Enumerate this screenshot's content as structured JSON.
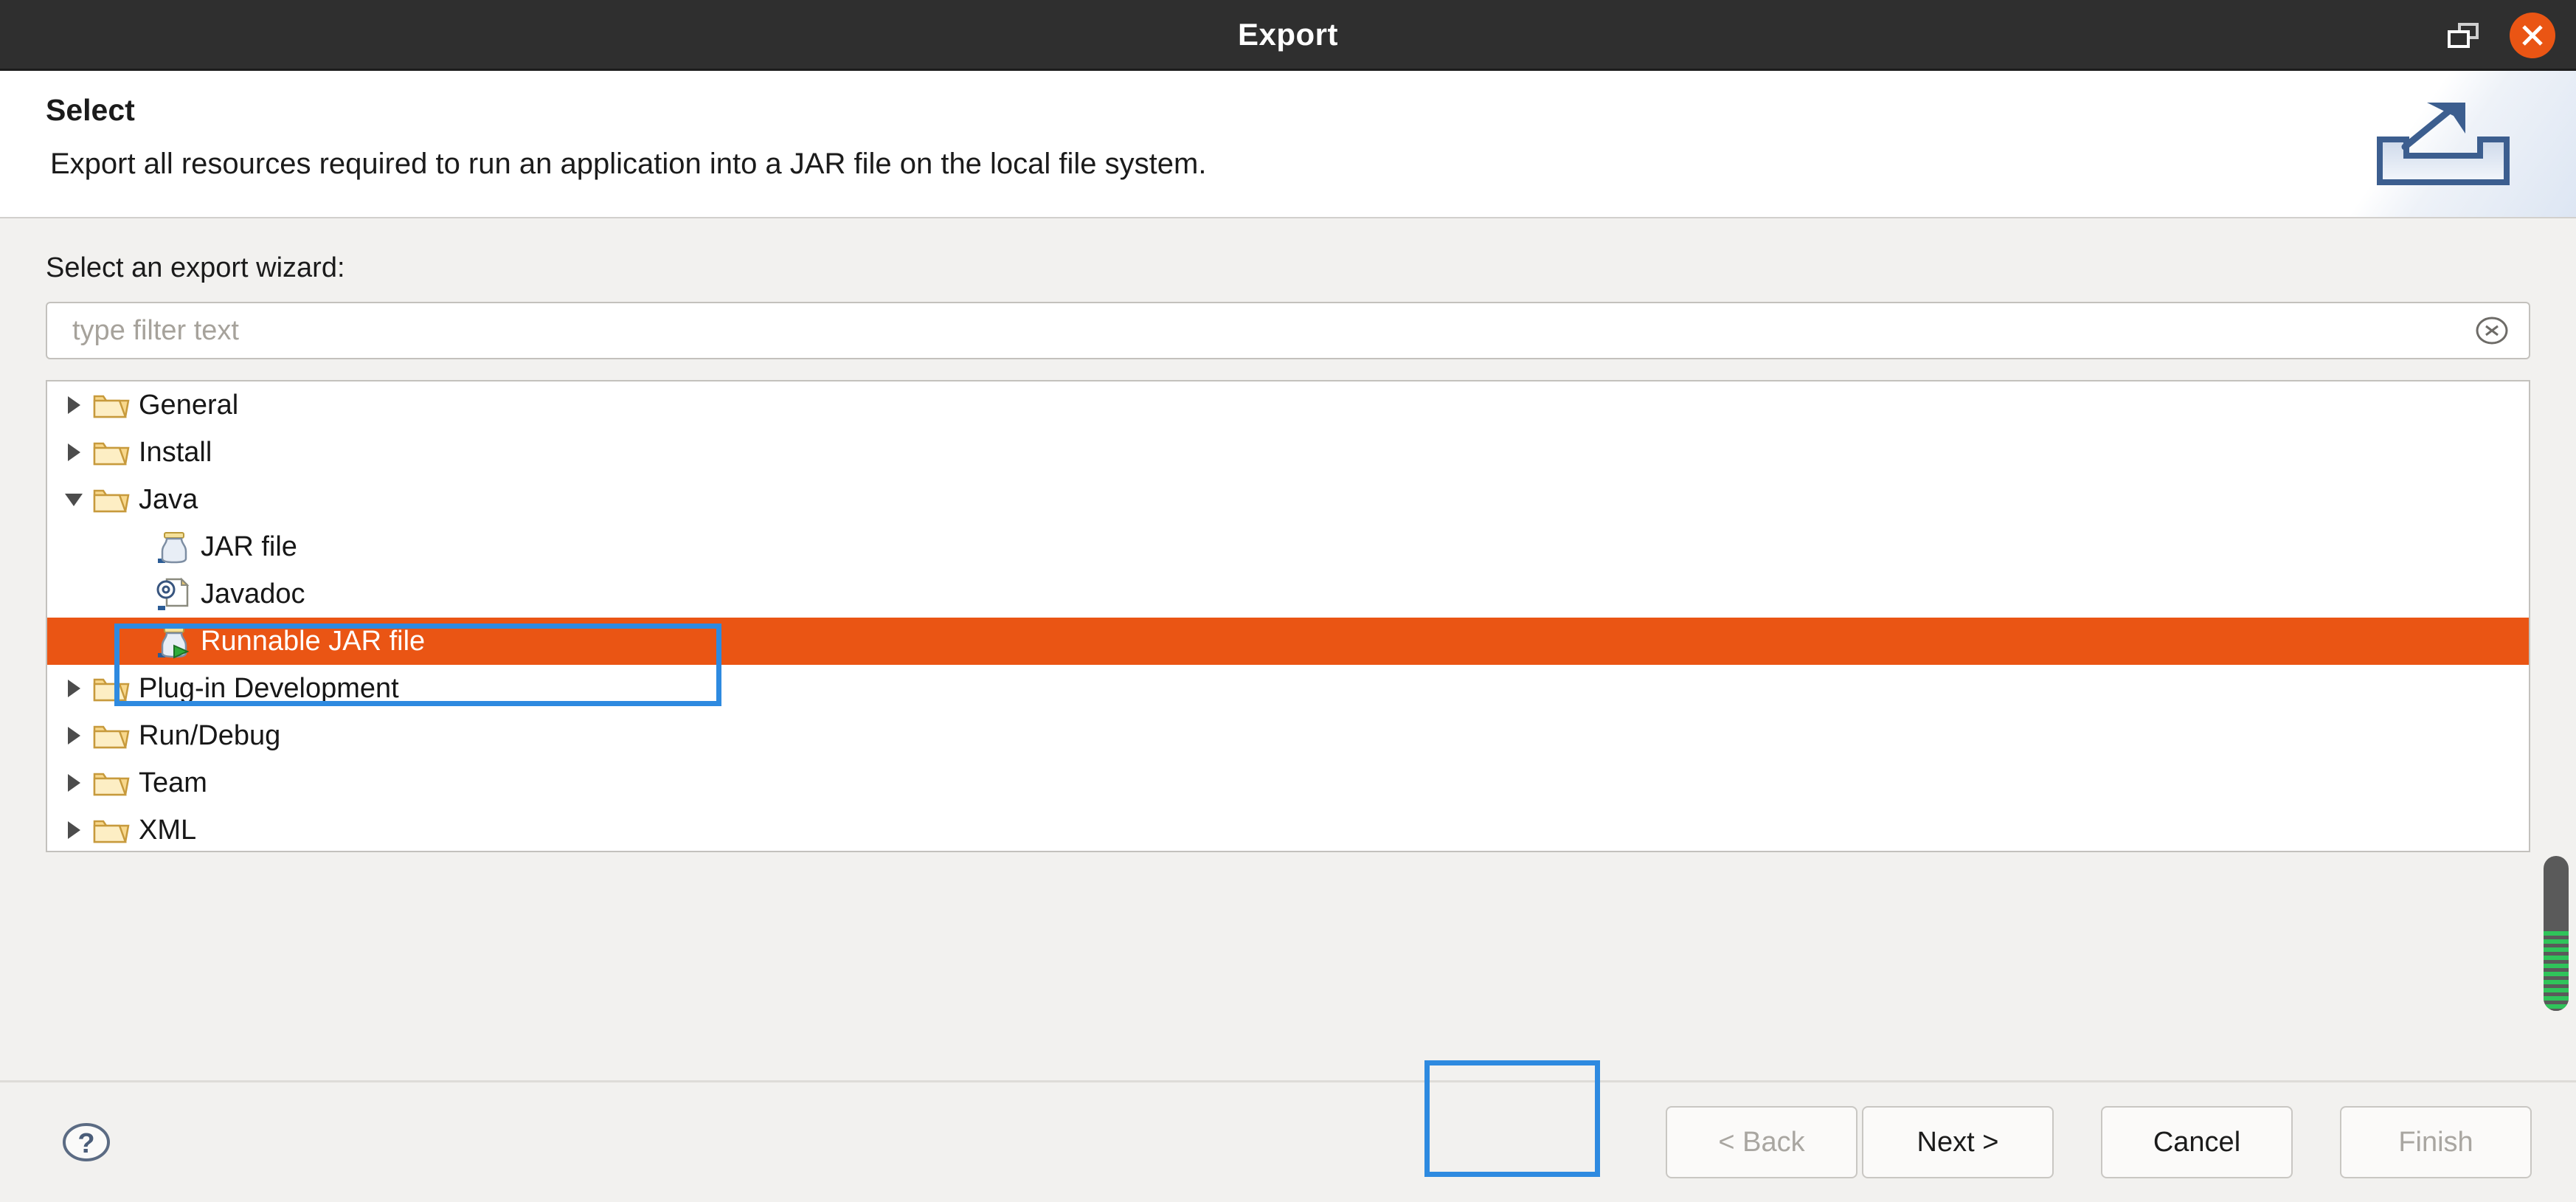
{
  "window": {
    "title": "Export",
    "restore_icon": "restore-icon",
    "close_icon": "close-icon"
  },
  "banner": {
    "title": "Select",
    "description": "Export all resources required to run an application into a JAR file on the local file system.",
    "graphic_icon": "export-banner-icon"
  },
  "main": {
    "wizard_label": "Select an export wizard:",
    "filter": {
      "value": "",
      "placeholder": "type filter text",
      "clear_icon": "clear-icon"
    },
    "tree": [
      {
        "label": "General",
        "icon": "folder-icon",
        "level": 0,
        "expanded": false,
        "selected": false
      },
      {
        "label": "Install",
        "icon": "folder-icon",
        "level": 0,
        "expanded": false,
        "selected": false
      },
      {
        "label": "Java",
        "icon": "folder-icon",
        "level": 0,
        "expanded": true,
        "selected": false
      },
      {
        "label": "JAR file",
        "icon": "jar-file-icon",
        "level": 1,
        "expanded": null,
        "selected": false
      },
      {
        "label": "Javadoc",
        "icon": "javadoc-icon",
        "level": 1,
        "expanded": null,
        "selected": false
      },
      {
        "label": "Runnable JAR file",
        "icon": "runnable-jar-icon",
        "level": 1,
        "expanded": null,
        "selected": true
      },
      {
        "label": "Plug-in Development",
        "icon": "folder-icon",
        "level": 0,
        "expanded": false,
        "selected": false
      },
      {
        "label": "Run/Debug",
        "icon": "folder-icon",
        "level": 0,
        "expanded": false,
        "selected": false
      },
      {
        "label": "Team",
        "icon": "folder-icon",
        "level": 0,
        "expanded": false,
        "selected": false
      },
      {
        "label": "XML",
        "icon": "folder-icon",
        "level": 0,
        "expanded": false,
        "selected": false
      }
    ]
  },
  "footer": {
    "help_icon": "help-icon",
    "back_label": "< Back",
    "back_enabled": false,
    "next_label": "Next >",
    "next_enabled": true,
    "cancel_label": "Cancel",
    "cancel_enabled": true,
    "finish_label": "Finish",
    "finish_enabled": false
  },
  "colors": {
    "selection": "#ea5514",
    "titlebar": "#2f2f2f",
    "close_button": "#ea5514",
    "annotation": "#2e8ae0",
    "background": "#f2f1ef",
    "scrollbar_thumb": "#5a5a5a",
    "scrollbar_stripe": "#2fc45a"
  }
}
